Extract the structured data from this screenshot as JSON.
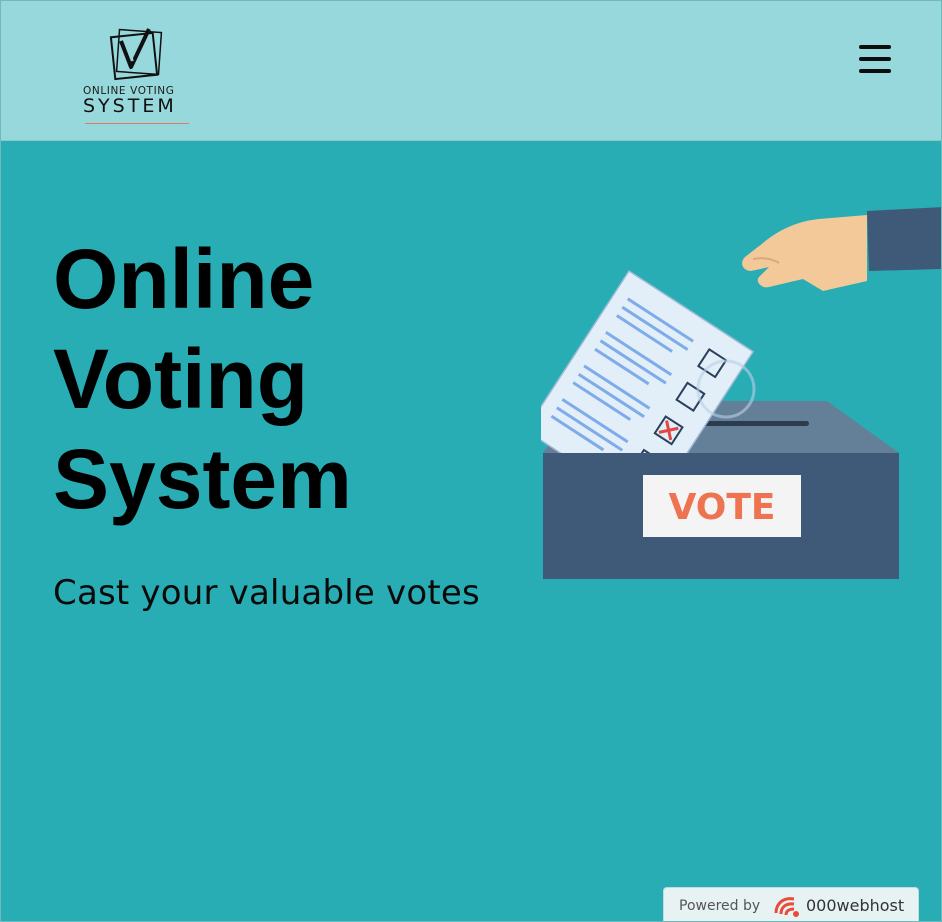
{
  "header": {
    "logo": {
      "line1": "ONLINE VOTING",
      "line2": "SYSTEM"
    },
    "menu_icon": "hamburger-menu-icon"
  },
  "hero": {
    "title_lines": [
      "Online",
      "Voting",
      "System"
    ],
    "subtitle": "Cast your valuable votes",
    "illustration": {
      "box_label": "VOTE"
    }
  },
  "footer": {
    "powered_label": "Powered by",
    "brand": "000webhost"
  },
  "colors": {
    "background": "#28adb5",
    "header": "#97d8dc",
    "ballot_box": "#3f5a78",
    "vote_label": "#ee7350"
  }
}
